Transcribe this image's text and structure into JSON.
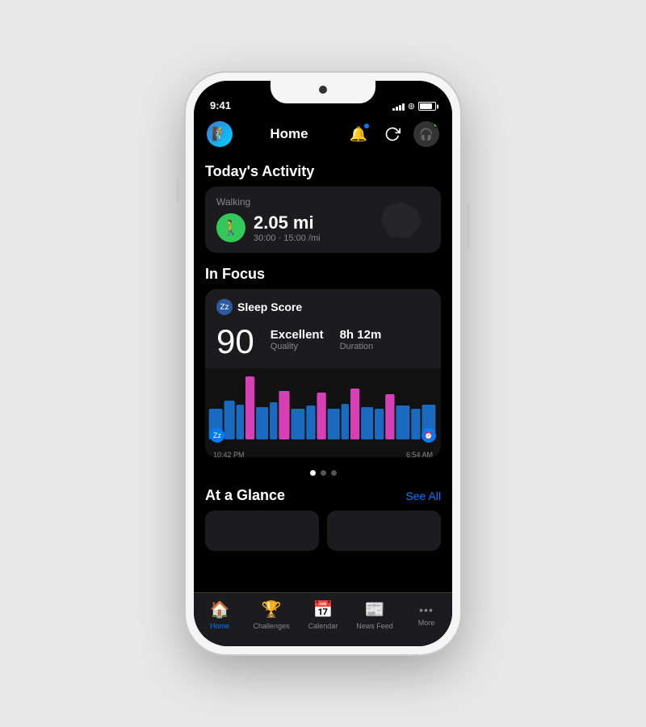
{
  "phone": {
    "status_bar": {
      "time": "9:41",
      "battery_percent": 85
    },
    "header": {
      "title": "Home",
      "refresh_label": "refresh",
      "notification_label": "notifications",
      "profile_label": "profile"
    },
    "today_activity": {
      "section_title": "Today's Activity",
      "card": {
        "type_label": "Walking",
        "distance": "2.05 mi",
        "sub": "30:00 · 15:00 /mi"
      }
    },
    "in_focus": {
      "section_title": "In Focus",
      "sleep_card": {
        "label": "Sleep Score",
        "score": "90",
        "quality_value": "Excellent",
        "quality_label": "Quality",
        "duration_value": "8h 12m",
        "duration_label": "Duration",
        "time_start": "10:42 PM",
        "time_end": "6:54 AM"
      }
    },
    "at_glance": {
      "section_title": "At a Glance",
      "see_all_label": "See All"
    },
    "tab_bar": {
      "items": [
        {
          "id": "home",
          "label": "Home",
          "icon": "🏠",
          "active": true
        },
        {
          "id": "challenges",
          "label": "Challenges",
          "icon": "🏆",
          "active": false
        },
        {
          "id": "calendar",
          "label": "Calendar",
          "icon": "📅",
          "active": false
        },
        {
          "id": "newsfeed",
          "label": "News Feed",
          "icon": "📰",
          "active": false
        },
        {
          "id": "more",
          "label": "More",
          "icon": "•••",
          "active": false
        }
      ]
    },
    "dots": {
      "items": [
        {
          "active": true,
          "color": "#fff"
        },
        {
          "active": false,
          "color": "#555"
        },
        {
          "active": false,
          "color": "#555"
        }
      ]
    }
  }
}
